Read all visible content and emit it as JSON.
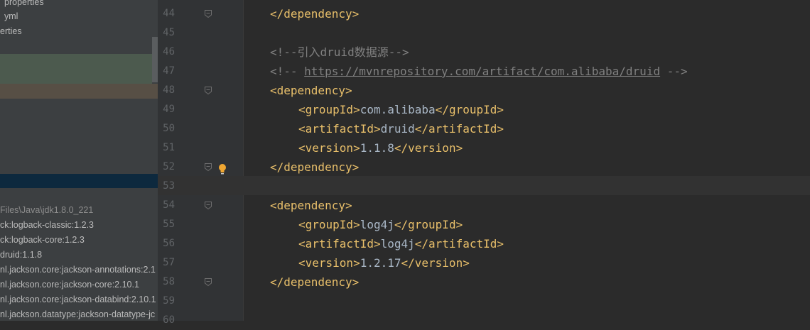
{
  "sidebar": {
    "items": [
      "properties",
      "yml",
      "erties"
    ],
    "libraries": [
      "Files\\Java\\jdk1.8.0_221",
      "ck:logback-classic:1.2.3",
      "ck:logback-core:1.2.3",
      "druid:1.1.8",
      "nl.jackson.core:jackson-annotations:2.1",
      "nl.jackson.core:jackson-core:2.10.1",
      "nl.jackson.core:jackson-databind:2.10.1",
      "nl.jackson.datatype:jackson-datatype-jc"
    ]
  },
  "editor": {
    "current_line": "53",
    "lines": [
      {
        "num": "44",
        "parts": [
          [
            "tag",
            "</dependency>"
          ]
        ]
      },
      {
        "num": "45",
        "parts": []
      },
      {
        "num": "46",
        "parts": [
          [
            "cmt",
            "<!--引入druid数据源-->"
          ]
        ]
      },
      {
        "num": "47",
        "parts": [
          [
            "cmt",
            "<!-- "
          ],
          [
            "link",
            "https://mvnrepository.com/artifact/com.alibaba/druid"
          ],
          [
            "cmt",
            " -->"
          ]
        ]
      },
      {
        "num": "48",
        "parts": [
          [
            "tag",
            "<dependency>"
          ]
        ]
      },
      {
        "num": "49",
        "parts": [
          [
            "tag",
            "<groupId>"
          ],
          [
            "txt",
            "com.alibaba"
          ],
          [
            "tag",
            "</groupId>"
          ]
        ]
      },
      {
        "num": "50",
        "parts": [
          [
            "tag",
            "<artifactId>"
          ],
          [
            "txt",
            "druid"
          ],
          [
            "tag",
            "</artifactId>"
          ]
        ]
      },
      {
        "num": "51",
        "parts": [
          [
            "tag",
            "<version>"
          ],
          [
            "txt",
            "1.1.8"
          ],
          [
            "tag",
            "</version>"
          ]
        ]
      },
      {
        "num": "52",
        "parts": [
          [
            "tag",
            "</dependency>"
          ]
        ]
      },
      {
        "num": "53",
        "parts": []
      },
      {
        "num": "54",
        "parts": [
          [
            "tag",
            "<dependency>"
          ]
        ]
      },
      {
        "num": "55",
        "parts": [
          [
            "tag",
            "<groupId>"
          ],
          [
            "txt",
            "log4j"
          ],
          [
            "tag",
            "</groupId>"
          ]
        ]
      },
      {
        "num": "56",
        "parts": [
          [
            "tag",
            "<artifactId>"
          ],
          [
            "txt",
            "log4j"
          ],
          [
            "tag",
            "</artifactId>"
          ]
        ]
      },
      {
        "num": "57",
        "parts": [
          [
            "tag",
            "<version>"
          ],
          [
            "txt",
            "1.2.17"
          ],
          [
            "tag",
            "</version>"
          ]
        ]
      },
      {
        "num": "58",
        "parts": [
          [
            "tag",
            "</dependency>"
          ]
        ]
      },
      {
        "num": "59",
        "parts": []
      },
      {
        "num": "60",
        "parts": []
      }
    ],
    "fold_markers": [
      "44",
      "48",
      "52",
      "54",
      "58"
    ],
    "intention_bulb_line": "52",
    "colors": {
      "tag": "#e8bf6a",
      "comment": "#808080",
      "text": "#a9b7c6",
      "background": "#2b2b2b",
      "current_line": "#323232"
    }
  }
}
